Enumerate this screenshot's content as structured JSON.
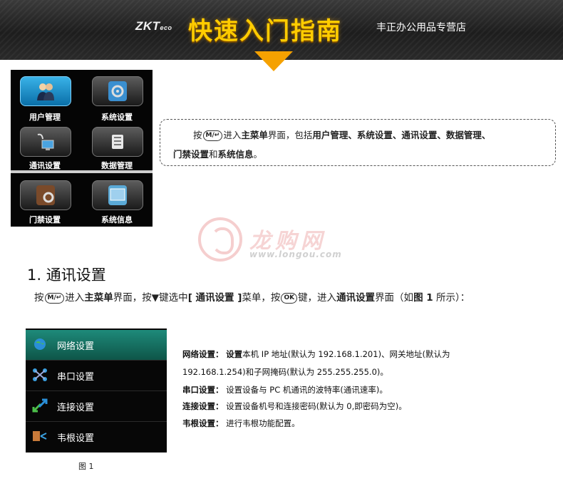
{
  "banner": {
    "brand": "ZKT",
    "brand_suffix": "eco",
    "title": "快速入门指南",
    "store": "丰正办公用品专营店",
    "arrow_color": "#f5a100"
  },
  "menu": {
    "items": [
      {
        "label": "用户管理",
        "icon": "users-icon",
        "active": true
      },
      {
        "label": "系统设置",
        "icon": "gear-monitor-icon"
      },
      {
        "label": "通讯设置",
        "icon": "satellite-computer-icon"
      },
      {
        "label": "数据管理",
        "icon": "database-icon"
      },
      {
        "label": "门禁设置",
        "icon": "door-gear-icon"
      },
      {
        "label": "系统信息",
        "icon": "screen-info-icon"
      }
    ]
  },
  "note": {
    "press": "按",
    "key": "M/↵",
    "enter": "进入",
    "main_menu": "主菜单",
    "screen_include": "界面，包括",
    "items": "用户管理、系统设置、通讯设置、数据管理、",
    "items2a": "门禁设置",
    "and": "和",
    "items2b": "系统信息",
    "end": "。"
  },
  "watermark": {
    "cn": "龙购网",
    "url": "www.longou.com"
  },
  "section": {
    "title": "1. 通讯设置",
    "i1": "按",
    "key_m": "M/↵",
    "i2": "进入",
    "i3": "主菜单",
    "i4": "界面，按▼键选中",
    "i5": "[ 通讯设置 ]",
    "i6": "菜单，按",
    "key_ok": "OK",
    "i7": "键，进入",
    "i8": "通讯设置",
    "i9": "界面（如",
    "i10": "图 1",
    "i11": " 所示）："
  },
  "comm": {
    "items": [
      {
        "label": "网络设置",
        "icon": "globe-icon",
        "active": true
      },
      {
        "label": "串口设置",
        "icon": "serial-port-icon"
      },
      {
        "label": "连接设置",
        "icon": "connection-arrows-icon"
      },
      {
        "label": "韦根设置",
        "icon": "wiegand-icon"
      }
    ],
    "caption": "图 1"
  },
  "descriptions": {
    "network_label": "网络设置：",
    "network_bold": "设置",
    "network_text": "本机 IP 地址(默认为 192.168.1.201)、网关地址(默认为",
    "network_text2": "192.168.1.254)和子网掩码(默认为 255.255.255.0)。",
    "serial_label": "串口设置：",
    "serial_text": "设置设备与 PC 机通讯的波特率(通讯速率)。",
    "connect_label": "连接设置：",
    "connect_text": "设置设备机号和连接密码(默认为 0,即密码为空)。",
    "wiegand_label": "韦根设置：",
    "wiegand_text": "进行韦根功能配置。"
  }
}
